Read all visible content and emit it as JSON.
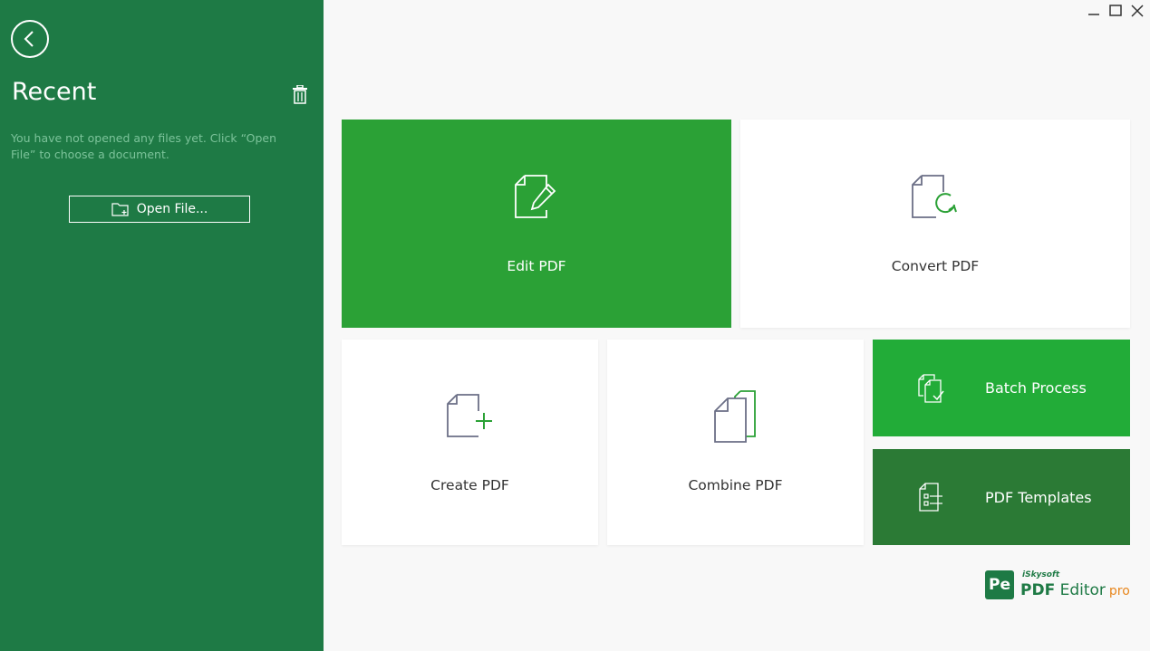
{
  "sidebar": {
    "title": "Recent",
    "empty_message": "You have not opened any files yet. Click “Open File” to choose a document.",
    "open_file_label": "Open File..."
  },
  "tiles": {
    "edit": "Edit PDF",
    "convert": "Convert PDF",
    "create": "Create PDF",
    "combine": "Combine PDF",
    "batch": "Batch Process",
    "templates": "PDF Templates"
  },
  "brand": {
    "badge": "Pe",
    "company": "iSkysoft",
    "product_bold": "PDF",
    "product_rest": "Editor",
    "edition": "pro"
  },
  "colors": {
    "sidebar_bg": "#1e7a45",
    "edit_tile": "#2ba136",
    "batch_tile": "#22ac38",
    "templates_tile": "#2b7a35",
    "accent_orange": "#e8871e"
  }
}
